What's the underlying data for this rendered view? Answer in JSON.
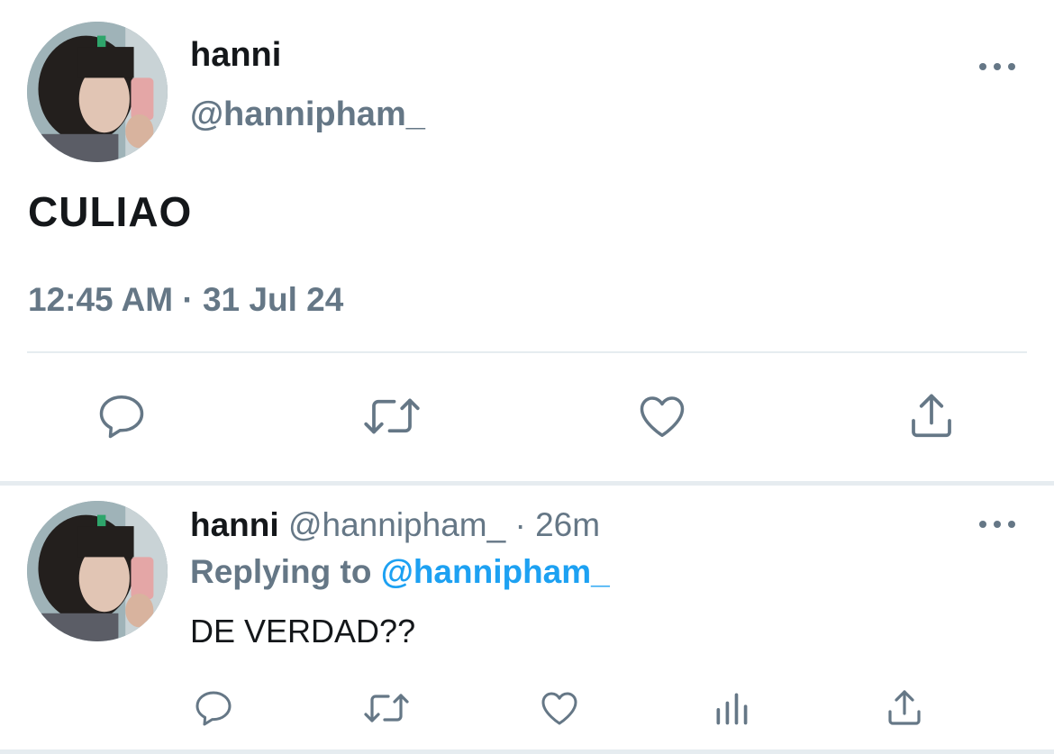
{
  "tweet": {
    "name": "hanni",
    "handle": "@hannipham_",
    "text": "CULIAO",
    "time": "12:45 AM",
    "separator": "·",
    "date": "31 Jul 24"
  },
  "actions": [
    "reply-icon",
    "retweet-icon",
    "like-icon",
    "share-icon"
  ],
  "reply": {
    "name": "hanni",
    "handle": "@hannipham_",
    "separator": "·",
    "age": "26m",
    "replying_label": "Replying to",
    "replying_handle": "@hannipham_",
    "text": "DE VERDAD??",
    "actions": [
      "reply-icon",
      "retweet-icon",
      "like-icon",
      "analytics-icon",
      "share-icon"
    ]
  },
  "colors": {
    "text": "#14171a",
    "secondary": "#657786",
    "link": "#1da1f2",
    "divider": "#e6ecf0"
  }
}
